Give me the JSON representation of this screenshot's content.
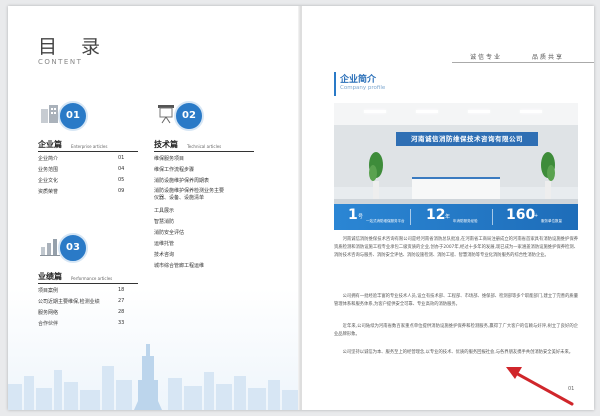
{
  "toc": {
    "title": "目 录",
    "subtitle": "CONTENT",
    "sections": [
      {
        "number": "01",
        "name": "企业篇",
        "name_en": "Enterprise articles",
        "icon": "building-icon",
        "items": [
          {
            "label": "企业简介",
            "page": "01"
          },
          {
            "label": "业务范围",
            "page": "04"
          },
          {
            "label": "企业文化",
            "page": "05"
          },
          {
            "label": "资质荣誉",
            "page": "09"
          }
        ]
      },
      {
        "number": "02",
        "name": "技术篇",
        "name_en": "Technical articles",
        "icon": "projector-icon",
        "items": [
          {
            "label": "维保服务项目",
            "page": ""
          },
          {
            "label": "维保工作流程步骤",
            "page": ""
          },
          {
            "label": "消防设施维护保养周期表",
            "page": ""
          },
          {
            "label": "消防设施维护保养检测业务主要仪器、设备、设施清单",
            "page": ""
          },
          {
            "label": "工具展示",
            "page": ""
          },
          {
            "label": "智慧消防",
            "page": ""
          },
          {
            "label": "消防安全评估",
            "page": ""
          },
          {
            "label": "运维托管",
            "page": ""
          },
          {
            "label": "技术咨询",
            "page": ""
          },
          {
            "label": "城市综合管廊工程运维",
            "page": ""
          }
        ]
      },
      {
        "number": "03",
        "name": "业绩篇",
        "name_en": "Performance articles",
        "icon": "chart-icon",
        "items": [
          {
            "label": "项目案例",
            "page": "18"
          },
          {
            "label": "公司近期主要维保,检测业绩",
            "page": "27"
          },
          {
            "label": "服务网络",
            "page": "28"
          },
          {
            "label": "合作伙伴",
            "page": "33"
          }
        ]
      }
    ]
  },
  "right_page": {
    "header_tags": [
      "诚信专业",
      "品质共享"
    ],
    "chapter_title": "企业简介",
    "chapter_subtitle": "Company profile",
    "photo_sign": "河南诚信消防维保技术咨询有限公司",
    "stats": [
      {
        "num": "1",
        "unit": "号",
        "desc": "一站式消防维保服务平台"
      },
      {
        "num": "12",
        "unit": "年",
        "desc": "年消防服务经验"
      },
      {
        "num": "160",
        "unit": "+",
        "desc": "服务单位数量"
      }
    ],
    "paragraphs": [
      "河南诚信消防维保技术咨询有限公司是经河南省消防总队批准,在河南省工商局注册成立的河南省首家具有消防设施维护保养资质检测和消防设施工程专业承包二级资质的企业,创办于2007年,经过十多年的发展,现已成为一家涵盖消防设施维护保养检测、消防技术咨询与服务、消防安全评估、消防设施检测、消防工程、智慧消防等专业化消防服务的综合性消防企业。",
      "公司拥有一批经验丰富的专业技术人员,设立有技术部、工程部、市场部、维保部、检测部等多个职能部门,建立了完善的质量管理体系和服务体系,为客户提供安全可靠、专业高效的消防服务。",
      "近年来,公司陆续为河南省数百家重点单位提供消防设施维护保养和检测服务,赢得了广大客户的信赖与好评,树立了良好的企业品牌形象。",
      "公司坚持以诚信为本、服务至上的经营理念,以专业的技术、优质的服务回报社会,与各界朋友携手共创消防安全美好未来。"
    ],
    "page_number": "01"
  },
  "colors": {
    "accent": "#2a7ac7",
    "accent_dark": "#1e6db9",
    "arrow": "#d0262b"
  }
}
